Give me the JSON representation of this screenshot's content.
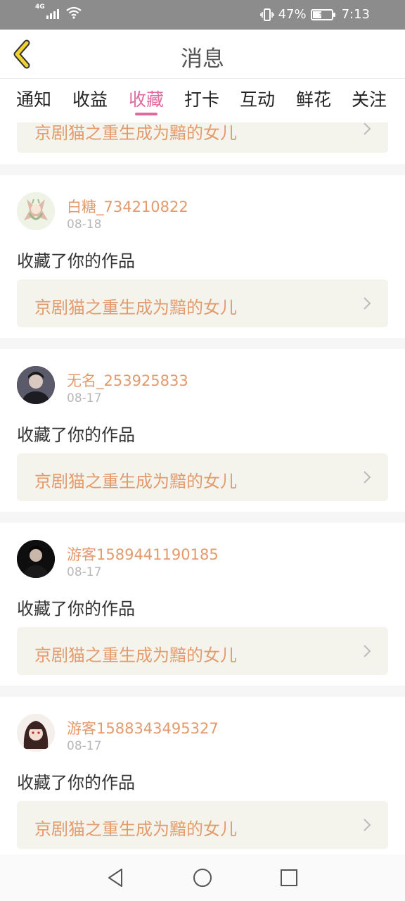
{
  "status_bar": {
    "network": "4G",
    "battery_percent": "47%",
    "battery_level": 0.47,
    "time": "7:13"
  },
  "header": {
    "title": "消息",
    "back_icon": "chevron-left-icon"
  },
  "tabs": [
    {
      "label": "通知"
    },
    {
      "label": "收益"
    },
    {
      "label": "收藏"
    },
    {
      "label": "打卡"
    },
    {
      "label": "互动"
    },
    {
      "label": "鲜花"
    },
    {
      "label": "关注"
    }
  ],
  "active_tab": "收藏",
  "partial_item": {
    "work_title": "京剧猫之重生成为黯的女儿"
  },
  "items": [
    {
      "username": "白糖_734210822",
      "date": "08-18",
      "action": "收藏了你的作品",
      "work_title": "京剧猫之重生成为黯的女儿"
    },
    {
      "username": "无名_253925833",
      "date": "08-17",
      "action": "收藏了你的作品",
      "work_title": "京剧猫之重生成为黯的女儿"
    },
    {
      "username": "游客1589441190185",
      "date": "08-17",
      "action": "收藏了你的作品",
      "work_title": "京剧猫之重生成为黯的女儿"
    },
    {
      "username": "游客1588343495327",
      "date": "08-17",
      "action": "收藏了你的作品",
      "work_title": "京剧猫之重生成为黯的女儿"
    }
  ],
  "colors": {
    "accent_pink": "#e06aa0",
    "username_orange": "#e39a6c",
    "status_bar_gray": "#8c8c8c",
    "back_icon_yellow": "#f2d230"
  },
  "nav_bar": {
    "icons": [
      "back-triangle-icon",
      "home-circle-icon",
      "recents-square-icon"
    ]
  }
}
